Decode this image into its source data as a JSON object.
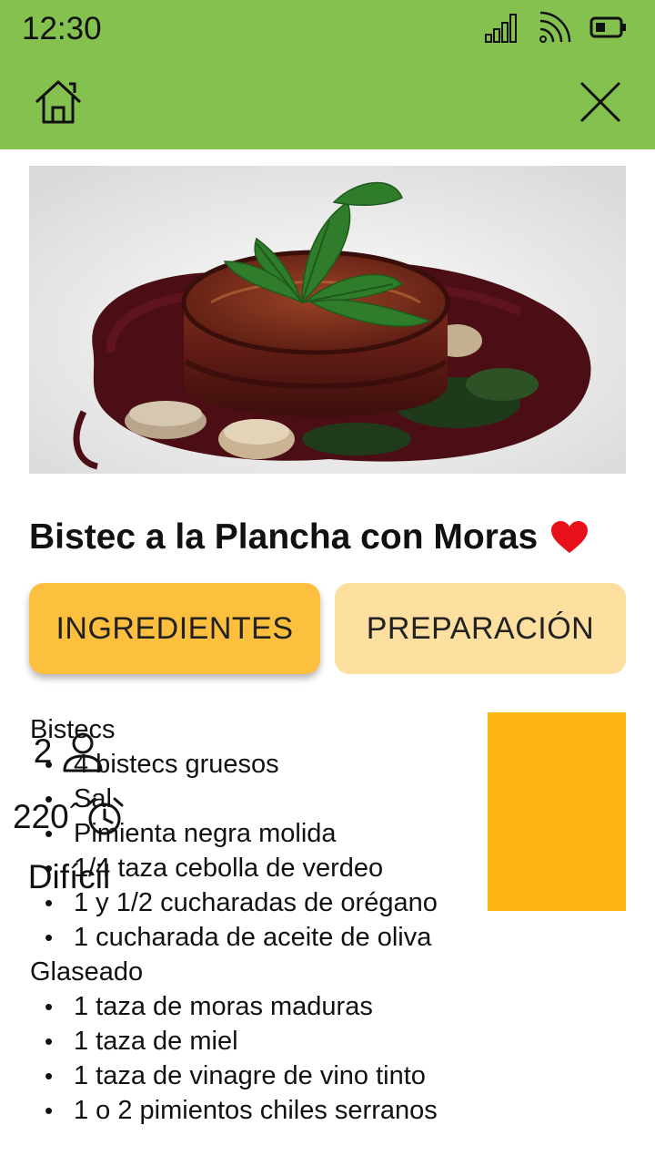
{
  "status_bar": {
    "time": "12:30",
    "icons": [
      "signal-icon",
      "wifi-icon",
      "battery-icon"
    ]
  },
  "toolbar": {
    "home_icon": "home-icon",
    "close_icon": "close-icon",
    "color": "#84c14f"
  },
  "recipe": {
    "title": "Bistec a la Plancha con Moras",
    "favorite": true,
    "favorite_color": "#e8101a"
  },
  "tabs": [
    {
      "label": "INGREDIENTES",
      "active": true,
      "color": "#fdbf3e"
    },
    {
      "label": "PREPARACIÓN",
      "active": false,
      "color": "#fde0a0"
    }
  ],
  "ingredients": {
    "groups": [
      {
        "title": "Bistecs",
        "items": [
          "4 bistecs gruesos",
          "Sal",
          "Pimienta negra molida",
          "1/4 taza cebolla de verdeo",
          "1 y 1/2 cucharadas de orégano",
          "1 cucharada de aceite de oliva"
        ]
      },
      {
        "title": "Glaseado",
        "items": [
          "1 taza de moras maduras",
          "1 taza de miel",
          "1 taza de vinagre de vino tinto",
          "1 o 2 pimientos chiles serranos"
        ]
      }
    ]
  },
  "info": {
    "servings": "2",
    "time": "220´",
    "difficulty": "Difícil",
    "color": "#fdb514"
  }
}
